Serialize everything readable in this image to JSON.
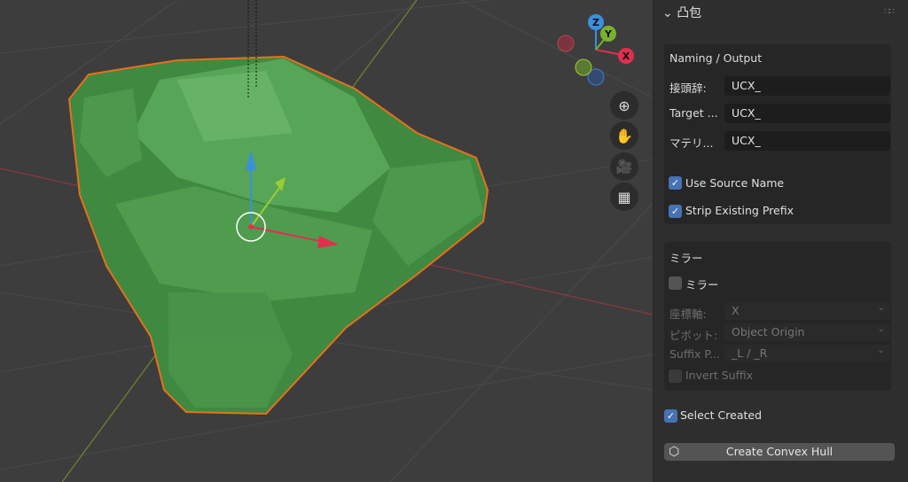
{
  "viewport": {
    "gizmo": {
      "z": "Z",
      "y": "Y",
      "x": "X"
    },
    "nav_buttons": [
      "zoom-icon",
      "hand-pan-icon",
      "camera-icon",
      "grid-icon"
    ],
    "colors": {
      "hull": "#4f9a4f",
      "outline": "#e8701a",
      "x_axis": "#e03050",
      "y_axis": "#7ab030",
      "z_axis": "#3b8fe0"
    }
  },
  "panel": {
    "title": "凸包",
    "naming": {
      "section_label": "Naming / Output",
      "fields": [
        {
          "label": "接頭辞:",
          "value": "UCX_"
        },
        {
          "label": "Target ...",
          "value": "UCX_"
        },
        {
          "label": "マテリ...",
          "value": "UCX_"
        }
      ],
      "use_source_name": {
        "label": "Use Source Name",
        "checked": true
      },
      "strip_prefix": {
        "label": "Strip Existing Prefix",
        "checked": true
      }
    },
    "mirror": {
      "section_label": "ミラー",
      "toggle": {
        "label": "ミラー",
        "checked": false
      },
      "axis": {
        "label": "座標軸:",
        "value": "X"
      },
      "pivot": {
        "label": "ピボット:",
        "value": "Object Origin"
      },
      "suffix": {
        "label": "Suffix P...",
        "value": "_L / _R"
      },
      "invert": {
        "label": "Invert Suffix",
        "checked": false
      }
    },
    "select_created": {
      "label": "Select Created",
      "checked": true
    },
    "create_button": "Create Convex Hull"
  }
}
